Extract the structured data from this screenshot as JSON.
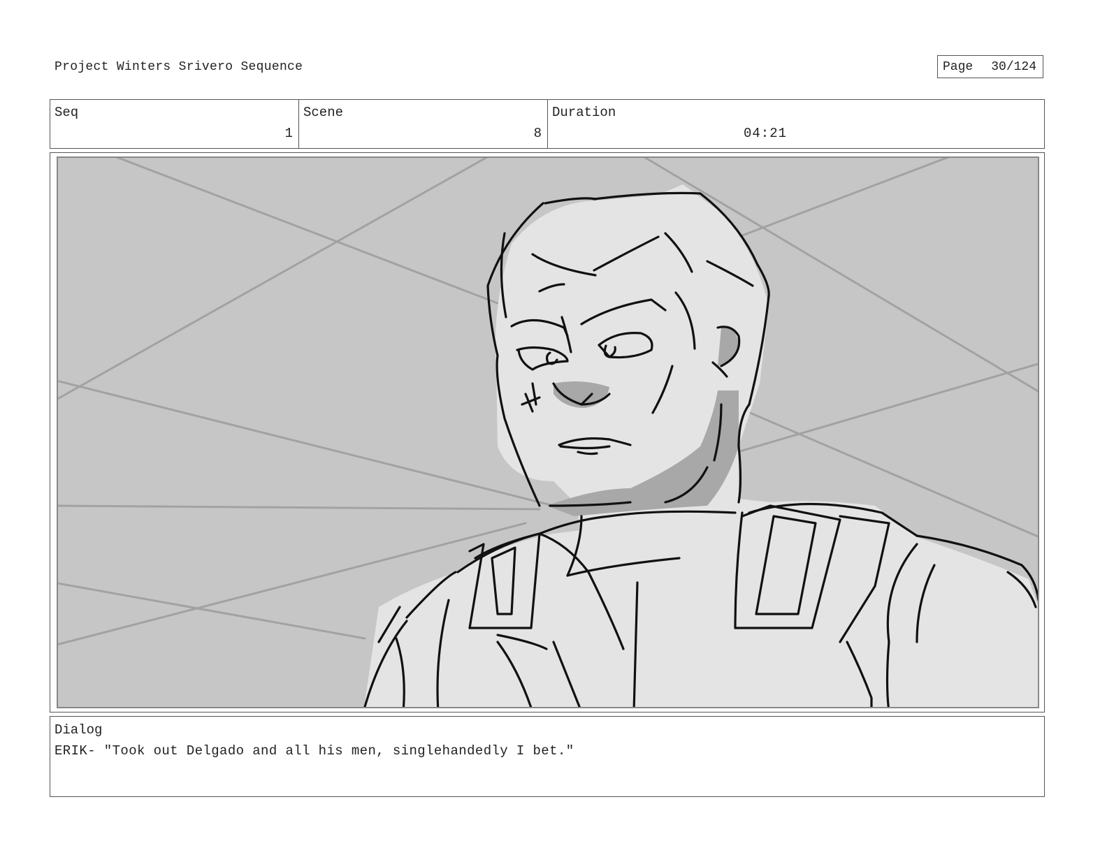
{
  "header": {
    "project_title": "Project Winters Srivero Sequence",
    "page_label": "Page",
    "page_number": "30/124"
  },
  "info": {
    "seq_label": "Seq",
    "seq_value": "1",
    "scene_label": "Scene",
    "scene_value": "8",
    "duration_label": "Duration",
    "duration_value": "04:21"
  },
  "panel": {
    "icon": "storyboard-sketch-image",
    "background_color": "#c6c6c6",
    "figure_fill": "#e4e4e4",
    "shadow_fill": "#a8a8a8",
    "line_color": "#111111"
  },
  "dialog": {
    "label": "Dialog",
    "text": "ERIK- \"Took out Delgado and all his men, singlehandedly I bet.\""
  }
}
